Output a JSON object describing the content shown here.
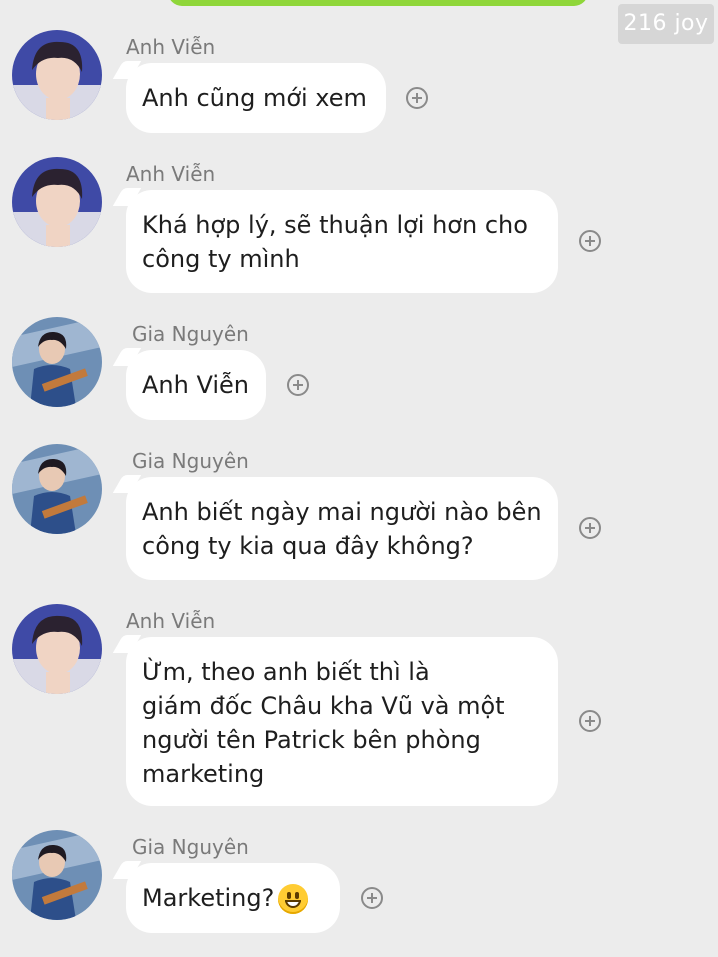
{
  "watermark": "216 joy",
  "messages": [
    {
      "sender": "Anh Viễn",
      "avatar": "avatar-anh-vien",
      "text": "Anh cũng mới xem"
    },
    {
      "sender": "Anh Viễn",
      "avatar": "avatar-anh-vien",
      "text": "Khá hợp lý, sẽ thuận lợi hơn cho\ncông ty mình"
    },
    {
      "sender": "Gia Nguyên",
      "avatar": "avatar-gia-nguyen",
      "text": "Anh Viễn"
    },
    {
      "sender": "Gia Nguyên",
      "avatar": "avatar-gia-nguyen",
      "text": "Anh biết ngày mai người nào bên\ncông ty kia qua đây không?"
    },
    {
      "sender": "Anh Viễn",
      "avatar": "avatar-anh-vien",
      "text": "Ừm, theo anh biết thì là\ngiám đốc Châu kha Vũ và một\nngười tên Patrick bên phòng\nmarketing"
    },
    {
      "sender": "Gia Nguyên",
      "avatar": "avatar-gia-nguyen",
      "text": "Marketing?",
      "emoji": "grinning-face-emoji"
    }
  ],
  "colors": {
    "background": "#ececec",
    "bubble": "#ffffff",
    "top_bar": "#8fd63a",
    "sender_text": "#7a7a7a"
  }
}
